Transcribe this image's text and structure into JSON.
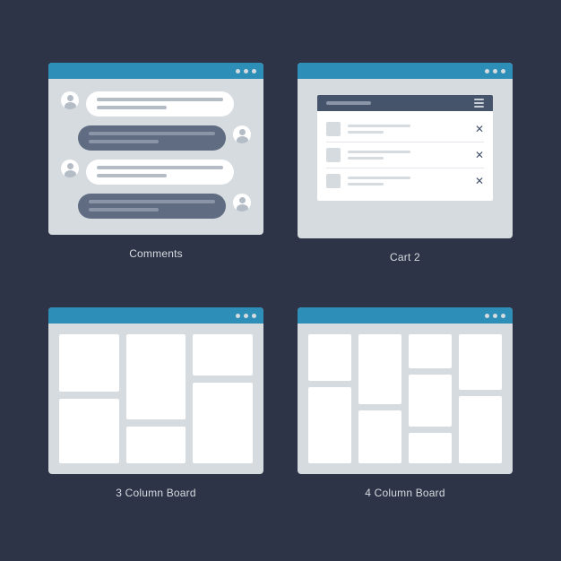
{
  "labels": {
    "comments": "Comments",
    "cart": "Cart 2",
    "board3": "3 Column Board",
    "board4": "4 Column Board"
  },
  "colors": {
    "background": "#2d3447",
    "titlebar": "#2d8fb8",
    "window": "#d6dbe0",
    "dark_bubble": "#5f6c81",
    "cart_header": "#45536b"
  }
}
